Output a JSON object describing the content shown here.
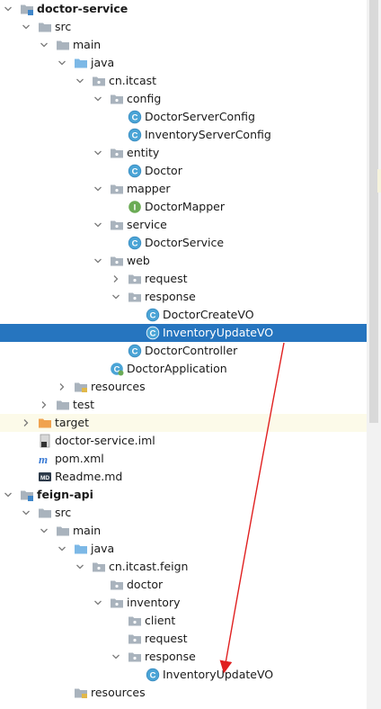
{
  "tree": [
    {
      "label": "doctor-service",
      "type": "module",
      "arrow": "down",
      "bold": true
    },
    {
      "label": "src",
      "type": "folder",
      "arrow": "down"
    },
    {
      "label": "main",
      "type": "folder",
      "arrow": "down"
    },
    {
      "label": "java",
      "type": "source-folder",
      "arrow": "down"
    },
    {
      "label": "cn.itcast",
      "type": "package",
      "arrow": "down"
    },
    {
      "label": "config",
      "type": "package",
      "arrow": "down"
    },
    {
      "label": "DoctorServerConfig",
      "type": "class"
    },
    {
      "label": "InventoryServerConfig",
      "type": "class"
    },
    {
      "label": "entity",
      "type": "package",
      "arrow": "down"
    },
    {
      "label": "Doctor",
      "type": "class"
    },
    {
      "label": "mapper",
      "type": "package",
      "arrow": "down"
    },
    {
      "label": "DoctorMapper",
      "type": "interface"
    },
    {
      "label": "service",
      "type": "package",
      "arrow": "down"
    },
    {
      "label": "DoctorService",
      "type": "class"
    },
    {
      "label": "web",
      "type": "package",
      "arrow": "down"
    },
    {
      "label": "request",
      "type": "package",
      "arrow": "right"
    },
    {
      "label": "response",
      "type": "package",
      "arrow": "down"
    },
    {
      "label": "DoctorCreateVO",
      "type": "class"
    },
    {
      "label": "InventoryUpdateVO",
      "type": "class",
      "selected": true
    },
    {
      "label": "DoctorController",
      "type": "class"
    },
    {
      "label": "DoctorApplication",
      "type": "spring-class"
    },
    {
      "label": "resources",
      "type": "resources-folder",
      "arrow": "right"
    },
    {
      "label": "test",
      "type": "folder",
      "arrow": "right"
    },
    {
      "label": "target",
      "type": "excluded-folder",
      "arrow": "right",
      "highlight": true
    },
    {
      "label": "doctor-service.iml",
      "type": "iml-file"
    },
    {
      "label": "pom.xml",
      "type": "maven-file"
    },
    {
      "label": "Readme.md",
      "type": "md-file"
    },
    {
      "label": "feign-api",
      "type": "module",
      "arrow": "down",
      "bold": true
    },
    {
      "label": "src",
      "type": "folder",
      "arrow": "down"
    },
    {
      "label": "main",
      "type": "folder",
      "arrow": "down"
    },
    {
      "label": "java",
      "type": "source-folder",
      "arrow": "down"
    },
    {
      "label": "cn.itcast.feign",
      "type": "package",
      "arrow": "down"
    },
    {
      "label": "doctor",
      "type": "package"
    },
    {
      "label": "inventory",
      "type": "package",
      "arrow": "down"
    },
    {
      "label": "client",
      "type": "package"
    },
    {
      "label": "request",
      "type": "package"
    },
    {
      "label": "response",
      "type": "package",
      "arrow": "down"
    },
    {
      "label": "InventoryUpdateVO",
      "type": "class"
    },
    {
      "label": "resources",
      "type": "resources-folder"
    }
  ],
  "colors": {
    "selection": "#2675bf",
    "highlight": "#fcfae9",
    "folder": "#a9b3bd",
    "source_folder": "#7cb8e6",
    "module": "#3f86c9",
    "class_circle": "#4aa4d6",
    "interface_circle": "#6bab55",
    "excluded_folder": "#f0a24e",
    "arrow_annotation": "#e02020"
  }
}
